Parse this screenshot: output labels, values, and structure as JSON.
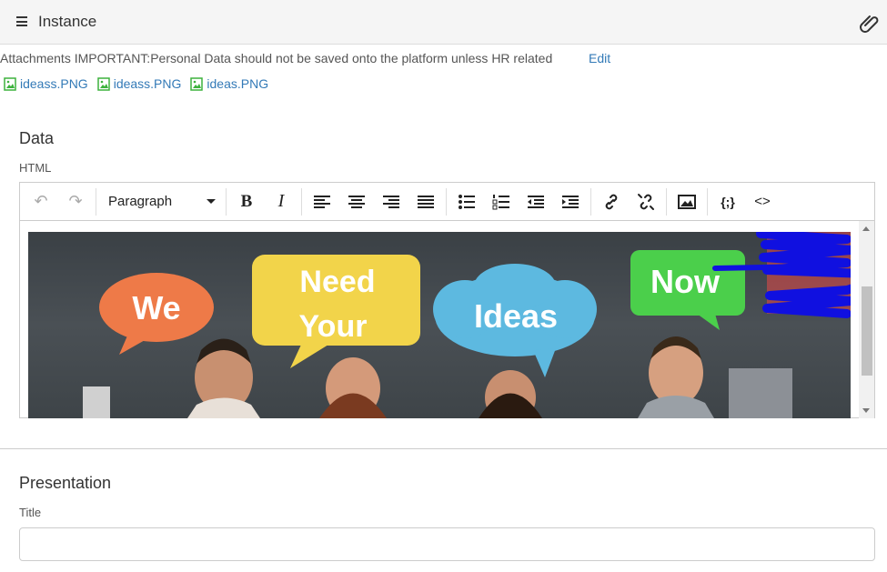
{
  "header": {
    "title": "Instance",
    "menu_icon": "hamburger-icon",
    "attach_icon": "paperclip-icon"
  },
  "attachments": {
    "notice": "Attachments IMPORTANT:Personal Data should not be saved onto the platform unless HR related",
    "edit_label": "Edit",
    "files": [
      "ideass.PNG",
      "ideass.PNG",
      "ideas.PNG"
    ]
  },
  "data_section": {
    "title": "Data",
    "html_label": "HTML",
    "format_select": "Paragraph",
    "banner_words": [
      "We",
      "Need",
      "Your",
      "Ideas",
      "Now"
    ]
  },
  "presentation": {
    "title": "Presentation",
    "title_label": "Title",
    "title_value": ""
  },
  "colors": {
    "link": "#337ab7",
    "file_icon": "#3db23d",
    "bubble_orange": "#ee7a48",
    "bubble_yellow": "#f2d44a",
    "bubble_blue": "#5db9e0",
    "bubble_green": "#4bcf4b",
    "scribble": "#1010e0"
  }
}
